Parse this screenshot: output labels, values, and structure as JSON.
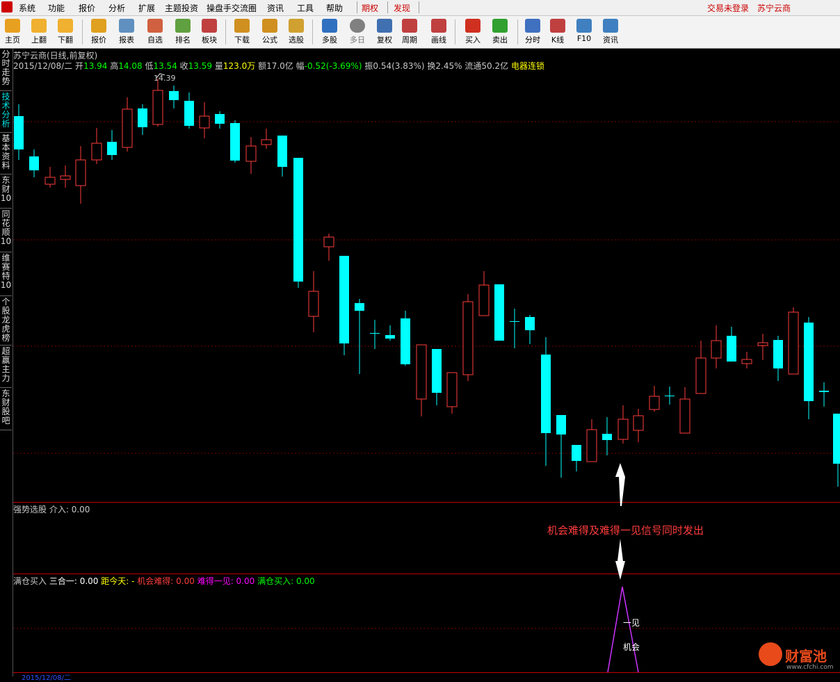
{
  "menu": {
    "items": [
      "系统",
      "功能",
      "报价",
      "分析",
      "扩展",
      "主题投资",
      "操盘手交流圈",
      "资讯",
      "工具",
      "帮助"
    ],
    "special": [
      "期权",
      "发现"
    ],
    "login": "交易未登录",
    "stock": "苏宁云商"
  },
  "toolbar": {
    "buttons": [
      {
        "label": "主页",
        "icon": "home-icon",
        "color": "#e8a020"
      },
      {
        "label": "上翻",
        "icon": "up-arrow-icon",
        "color": "#f0b030"
      },
      {
        "label": "下翻",
        "icon": "down-arrow-icon",
        "color": "#f0b030"
      },
      {
        "label": "报价",
        "icon": "yen-icon",
        "color": "#e0a020"
      },
      {
        "label": "报表",
        "icon": "report-icon",
        "color": "#6090c0"
      },
      {
        "label": "自选",
        "icon": "f6-icon",
        "color": "#d06040"
      },
      {
        "label": "排名",
        "icon": "rank-icon",
        "color": "#60a040"
      },
      {
        "label": "板块",
        "icon": "sector-icon",
        "color": "#c04040"
      },
      {
        "label": "下载",
        "icon": "download-icon",
        "color": "#d09020"
      },
      {
        "label": "公式",
        "icon": "formula-icon",
        "color": "#d09020"
      },
      {
        "label": "选股",
        "icon": "select-stock-icon",
        "color": "#d0a030"
      },
      {
        "label": "多股",
        "icon": "multi-stock-icon",
        "color": "#3070c0"
      },
      {
        "label": "多日",
        "icon": "clock-icon",
        "color": "#808080"
      },
      {
        "label": "复权",
        "icon": "restore-right-icon",
        "color": "#4070b0"
      },
      {
        "label": "周期",
        "icon": "f8-icon",
        "color": "#c04040"
      },
      {
        "label": "画线",
        "icon": "draw-line-icon",
        "color": "#c04040"
      },
      {
        "label": "买入",
        "icon": "buy-icon",
        "color": "#d03020"
      },
      {
        "label": "卖出",
        "icon": "sell-icon",
        "color": "#30a030"
      },
      {
        "label": "分时",
        "icon": "intraday-icon",
        "color": "#4070c0"
      },
      {
        "label": "K线",
        "icon": "kline-icon",
        "color": "#c04040"
      },
      {
        "label": "F10",
        "icon": "f10-icon",
        "color": "#4080c0"
      },
      {
        "label": "资讯",
        "icon": "news-icon",
        "color": "#4080c0"
      }
    ]
  },
  "side_tabs": [
    "分时走势",
    "技术分析",
    "基本资料",
    "东财10",
    "同花顺10",
    "维赛特10",
    "个股龙虎榜",
    "超赢主力",
    "东财股吧"
  ],
  "header": {
    "title": "苏宁云商(日线,前复权)",
    "date": "2015/12/08/二",
    "open_label": "开",
    "open": "13.94",
    "high_label": "高",
    "high": "14.08",
    "low_label": "低",
    "low": "13.54",
    "close_label": "收",
    "close": "13.59",
    "vol_label": "量",
    "vol": "123.0万",
    "amt_label": "额",
    "amt": "17.0亿",
    "chg_label": "幅",
    "chg": "-0.52(-3.69%)",
    "amp_label": "振",
    "amp": "0.54(3.83%)",
    "turn_label": "换",
    "turn": "2.45%",
    "float_label": "流通",
    "float": "50.2亿",
    "sector": "电器连锁"
  },
  "peak_label": "14.39",
  "panel2": {
    "name": "强势选股",
    "item": "介入: 0.00"
  },
  "panel3": {
    "name": "满仓买入",
    "i1": "三合一: 0.00",
    "i2": "距今天: -",
    "i3": "机会难得: 0.00",
    "i4": "难得一见: 0.00",
    "i5": "满仓买入: 0.00"
  },
  "annotation": "机会难得及难得一见信号同时发出",
  "signal_labels": {
    "top": "一见",
    "bottom": "机会"
  },
  "bottom_date": "2015/12/08/二",
  "watermark": {
    "name": "财富池",
    "url": "www.cfchi.com"
  },
  "colors": {
    "up": "#ff3c3c",
    "down": "#00ffff",
    "panel_line": "#c00000",
    "signal": "#cc33ff"
  },
  "chart_data": {
    "type": "candlestick",
    "peak_high": 14.39,
    "last_candle": {
      "open": 13.94,
      "high": 14.08,
      "low": 13.54,
      "close": 13.59
    }
  }
}
